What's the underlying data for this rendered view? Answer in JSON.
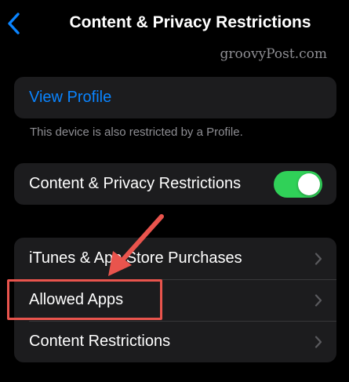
{
  "nav": {
    "back_icon": "chevron-left-icon",
    "title": "Content & Privacy Restrictions"
  },
  "watermark": "groovyPost.com",
  "profile_section": {
    "view_profile_label": "View Profile",
    "footnote": "This device is also restricted by a Profile."
  },
  "restrictions_toggle": {
    "label": "Content & Privacy Restrictions",
    "enabled": true
  },
  "menu": {
    "items": [
      {
        "label": "iTunes & App Store Purchases",
        "icon": "chevron-right-icon"
      },
      {
        "label": "Allowed Apps",
        "icon": "chevron-right-icon"
      },
      {
        "label": "Content Restrictions",
        "icon": "chevron-right-icon"
      }
    ]
  },
  "colors": {
    "accent_blue": "#0a84ff",
    "toggle_on": "#30d158",
    "annotation_red": "#e9544d",
    "group_bg": "#1c1c1e"
  }
}
